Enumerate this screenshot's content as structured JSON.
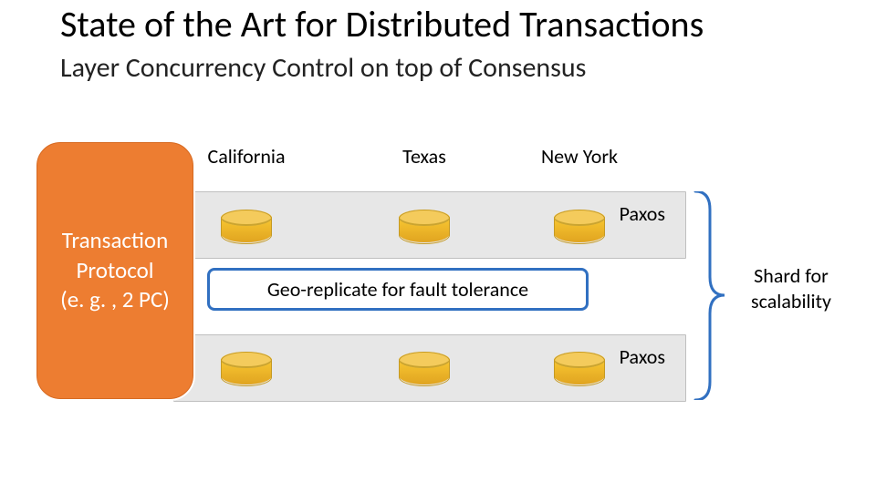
{
  "title": "State of the Art for Distributed Transactions",
  "subtitle": "Layer Concurrency Control on top of Consensus",
  "regions": [
    "California",
    "Texas",
    "New York"
  ],
  "paxos_label_1": "Paxos",
  "paxos_label_2": "Paxos",
  "geo_replicate": "Geo-replicate for fault tolerance",
  "shard": "Shard for scalability",
  "transaction_box": "Transaction Protocol\n(e. g. , 2 PC)"
}
